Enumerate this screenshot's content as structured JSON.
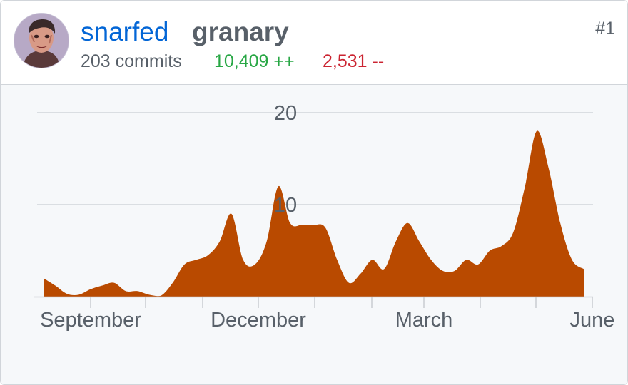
{
  "contributor": {
    "username": "snarfed",
    "repo": "granary",
    "rank": "#1",
    "commits": "203 commits",
    "additions": "10,409 ++",
    "deletions": "2,531 --"
  },
  "colors": {
    "accent": "#b94a00",
    "link": "#0366d6",
    "additions": "#28a745",
    "deletions": "#cb2431",
    "muted": "#586069",
    "grid": "#d1d5da"
  },
  "chart_data": {
    "type": "area",
    "title": "",
    "xlabel": "",
    "ylabel": "",
    "ylim": [
      0,
      20
    ],
    "y_ticks": [
      {
        "value": 10,
        "label": "10"
      },
      {
        "value": 20,
        "label": "20"
      }
    ],
    "x_ticks": [
      "September",
      "December",
      "March",
      "June"
    ],
    "x": [
      0,
      1,
      2,
      3,
      4,
      5,
      6,
      7,
      8,
      9,
      10,
      11,
      12,
      13,
      14,
      15,
      16,
      17,
      18,
      19,
      20,
      21,
      22,
      23,
      24,
      25,
      26,
      27,
      28,
      29,
      30,
      31,
      32,
      33,
      34,
      35,
      36,
      37,
      38,
      39,
      40,
      41,
      42,
      43,
      44,
      45,
      46,
      47,
      48,
      49,
      50
    ],
    "values": [
      2,
      1.2,
      0.3,
      0.2,
      0.8,
      1.2,
      1.5,
      0.6,
      0.6,
      0.2,
      0.1,
      1.5,
      3.5,
      4,
      4.5,
      6,
      9,
      4,
      3.5,
      6,
      12,
      8,
      7.8,
      7.8,
      7.5,
      4,
      1.5,
      2.5,
      4,
      3,
      6,
      8,
      6,
      4,
      2.8,
      2.8,
      4,
      3.5,
      5,
      5.5,
      7,
      12,
      18,
      14,
      8,
      4,
      3
    ],
    "grid": true,
    "legend": "none"
  }
}
